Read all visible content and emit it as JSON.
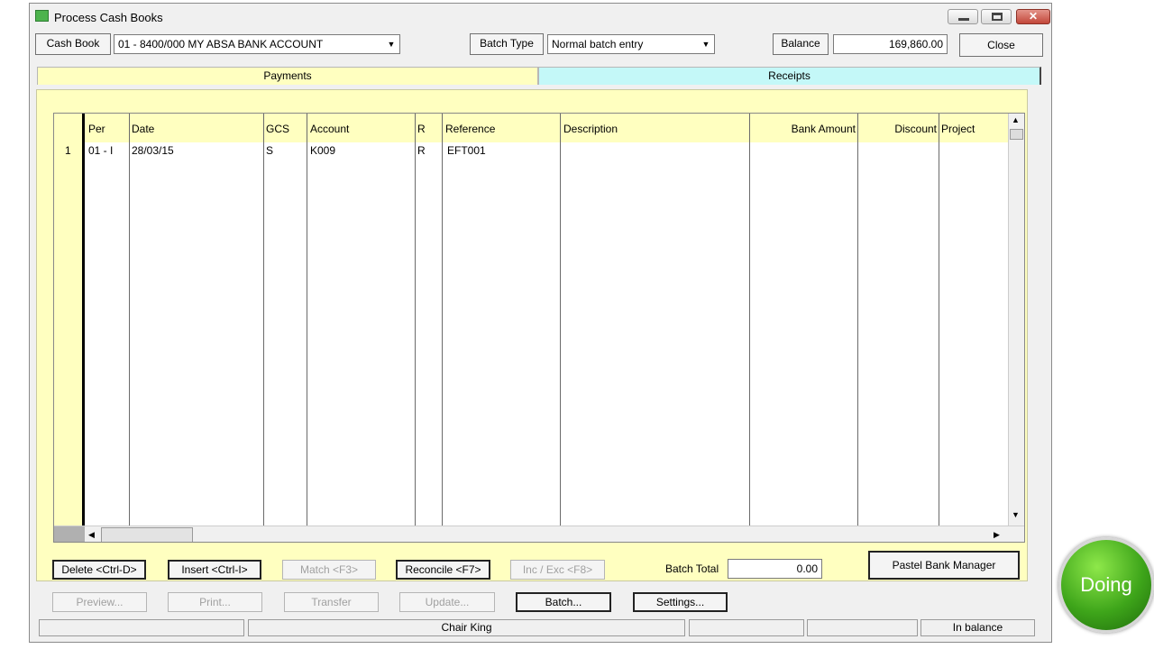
{
  "window": {
    "title": "Process Cash Books"
  },
  "toolbar": {
    "cash_book_label": "Cash Book",
    "cash_book_value": "01 - 8400/000 MY ABSA BANK ACCOUNT",
    "batch_type_label": "Batch Type",
    "batch_type_value": "Normal batch entry",
    "balance_label": "Balance",
    "balance_value": "169,860.00",
    "close_label": "Close"
  },
  "tabs": [
    {
      "label": "Payments"
    },
    {
      "label": "Receipts"
    }
  ],
  "grid": {
    "columns": [
      "Per",
      "Date",
      "GCS",
      "Account",
      "R",
      "Reference",
      "Description",
      "Bank Amount",
      "Discount",
      "Project"
    ],
    "rows": [
      {
        "num": "1",
        "per": "01 - I",
        "date": "28/03/15",
        "gcs": "S",
        "account": "K009",
        "r": "R",
        "reference": "EFT001",
        "description": "",
        "bank_amount": "",
        "discount": "",
        "project": ""
      }
    ]
  },
  "actions": {
    "delete": "Delete <Ctrl-D>",
    "insert": "Insert <Ctrl-I>",
    "match": "Match <F3>",
    "reconcile": "Reconcile <F7>",
    "inc_exc": "Inc / Exc <F8>",
    "batch_total_label": "Batch Total",
    "batch_total_value": "0.00",
    "pastel_bank_manager": "Pastel Bank Manager",
    "preview": "Preview...",
    "print": "Print...",
    "transfer": "Transfer",
    "update": "Update...",
    "batch": "Batch...",
    "settings": "Settings..."
  },
  "statusbar": {
    "user": "Chair King",
    "balance_status": "In balance"
  },
  "overlay": {
    "doing": "Doing"
  },
  "colors": {
    "panel": "#ffffc0",
    "receipts_tab": "#c4f8f8",
    "doing_badge": "#3ea51a"
  }
}
